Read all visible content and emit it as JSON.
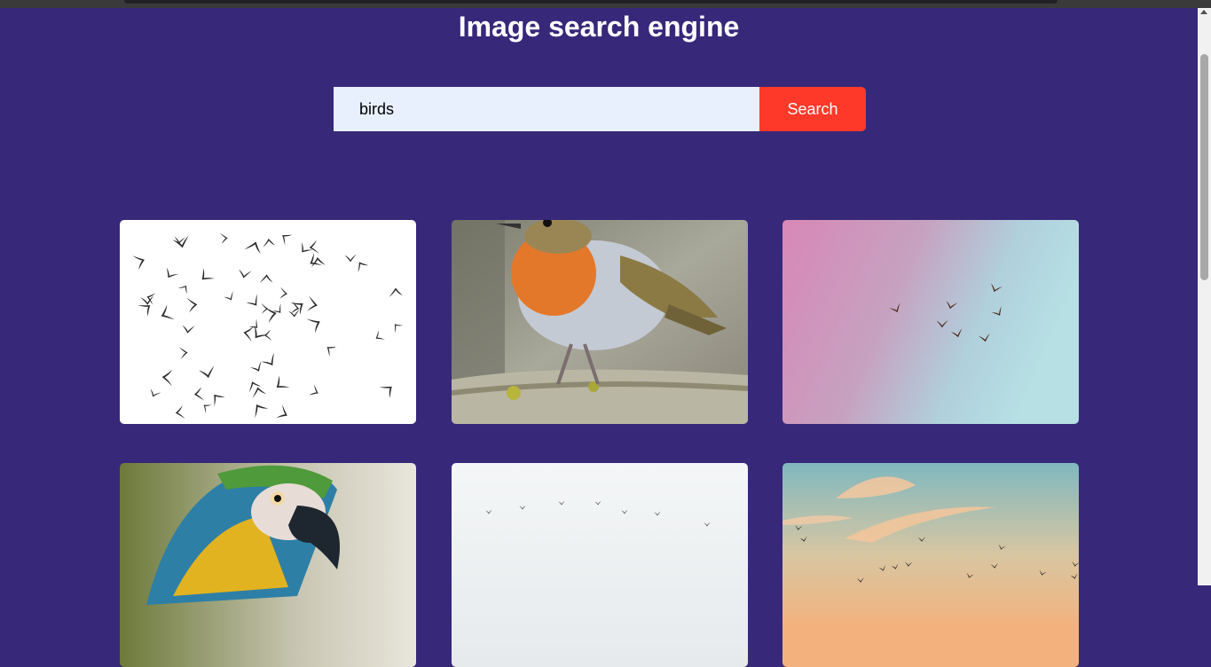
{
  "header": {
    "title": "Image search engine"
  },
  "search": {
    "value": "birds",
    "button_label": "Search"
  },
  "results": [
    {
      "subject": "flock of birds silhouettes on white"
    },
    {
      "subject": "robin perched on branch"
    },
    {
      "subject": "birds flying in pink-blue sky"
    },
    {
      "subject": "blue and yellow macaw parrot"
    },
    {
      "subject": "birds flying in formation on pale sky"
    },
    {
      "subject": "birds flying at sunset"
    }
  ],
  "colors": {
    "background": "#37287a",
    "accent": "#ff3929",
    "input_bg": "#e8f0fe"
  }
}
